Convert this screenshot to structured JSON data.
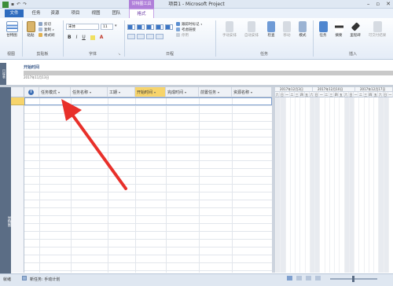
{
  "window": {
    "title": "项目1 - Microsoft Project"
  },
  "contextual_tab": {
    "label": "甘特图工具"
  },
  "tabs": [
    {
      "label": "文件"
    },
    {
      "label": "任务"
    },
    {
      "label": "资源"
    },
    {
      "label": "项目"
    },
    {
      "label": "视图"
    },
    {
      "label": "团队"
    },
    {
      "label": "格式"
    }
  ],
  "ribbon": {
    "view": {
      "button": "甘特图",
      "group": "视图"
    },
    "clipboard": {
      "paste": "粘贴",
      "cut": "剪切",
      "copy": "复制",
      "painter": "格式刷",
      "group": "剪贴板"
    },
    "font": {
      "name": "宋体",
      "size": "11",
      "bold": "B",
      "italic": "I",
      "underline": "U",
      "group": "字体"
    },
    "schedule": {
      "mark_track": "跟踪时标记",
      "respect_links": "考虑链接",
      "inactivate": "停用",
      "group": "日程"
    },
    "tasks": {
      "manual": "手动安排",
      "auto": "自动安排",
      "inspect": "检查",
      "move": "移动",
      "mode": "模式",
      "group": "任务"
    },
    "insert": {
      "task": "任务",
      "summary": "摘要",
      "milestone": "里程碑",
      "deliverable": "可交付结果",
      "group": "插入"
    }
  },
  "timeline": {
    "side_label": "日程表",
    "title": "开始时间",
    "date": "2017年11月13日"
  },
  "gantt": {
    "side_label": "甘特图"
  },
  "sheet": {
    "info_symbol": "i",
    "columns": [
      {
        "label": "任务模式"
      },
      {
        "label": "任务名称"
      },
      {
        "label": "工期"
      },
      {
        "label": "开始时间"
      },
      {
        "label": "完成时间"
      },
      {
        "label": "前置任务"
      },
      {
        "label": "资源名称"
      }
    ]
  },
  "chart_header": {
    "months": [
      "2017年12月3日",
      "2017年12月10日",
      "2017年12月17日"
    ],
    "days": [
      "六",
      "日",
      "一",
      "二",
      "三",
      "四",
      "五",
      "六",
      "日",
      "一",
      "二",
      "三",
      "四",
      "五",
      "六",
      "日",
      "一",
      "二",
      "三",
      "四",
      "五",
      "六",
      "日",
      "一"
    ]
  },
  "statusbar": {
    "ready": "就绪",
    "new_task": "新任务: 手动计划"
  },
  "colors": {
    "accent": "#2e6cbf",
    "selected_row": "#f7d46b",
    "arrow": "#e8302a"
  }
}
